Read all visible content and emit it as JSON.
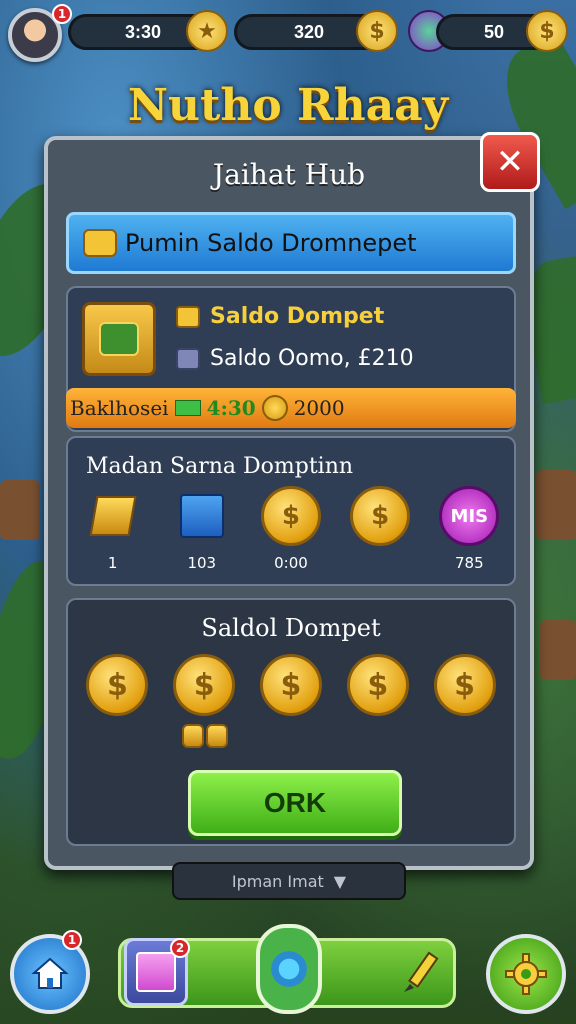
{
  "hud": {
    "gold_value": "3:30",
    "blue_value": "320",
    "gem_value": "50",
    "avatar_badge": "1"
  },
  "game_title": "Nutho Rhaay",
  "modal": {
    "title": "Jaihat Hub",
    "banner": "Pumin Saldo Dromnepet",
    "wallet": {
      "title": "Saldo Dompet",
      "sub": "Saldo Oomo, £210",
      "bar_label": "Baklhosei",
      "bar_value_1": "4:30",
      "bar_value_2": "2000"
    },
    "menu": {
      "title": "Madan Sarna Domptinn",
      "items": [
        {
          "label": "1",
          "icon": "gold-bar-icon"
        },
        {
          "label": "103",
          "icon": "gift-box-icon"
        },
        {
          "label": "0:00",
          "icon": "coin-icon"
        },
        {
          "label": "",
          "icon": "coin-icon"
        },
        {
          "label": "785",
          "icon": "gem-icon",
          "text": "MIS"
        }
      ]
    },
    "coins": {
      "title": "Saldol Dompet",
      "ok_label": "ORK"
    },
    "close_label": "✕"
  },
  "under_label": "Ipman Imat",
  "bottom_nav": {
    "home_badge": "1",
    "shop_badge": "2"
  },
  "colors": {
    "accent_gold": "#f7cf3c",
    "ok_green": "#3fae17",
    "close_red": "#d8262a",
    "banner_blue": "#1f7ad3",
    "bar_orange": "#e07a12"
  }
}
